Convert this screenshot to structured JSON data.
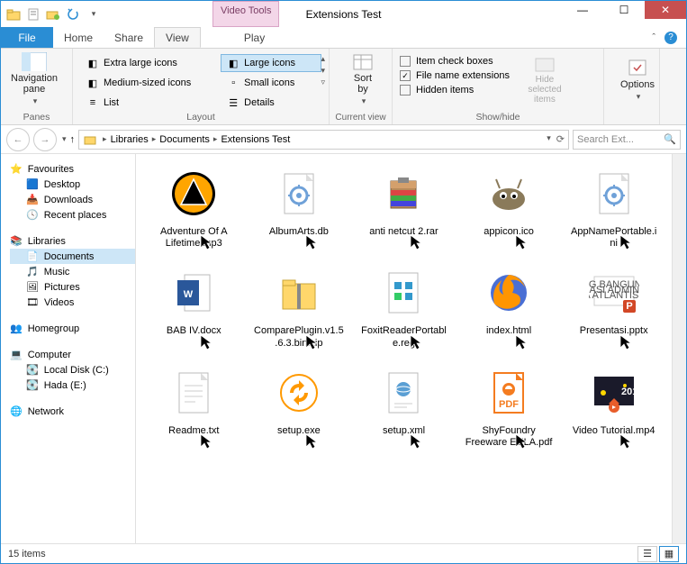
{
  "window": {
    "title": "Extensions Test",
    "tool_tab": "Video Tools"
  },
  "tabs": {
    "file": "File",
    "home": "Home",
    "share": "Share",
    "view": "View",
    "play": "Play"
  },
  "ribbon": {
    "panes": {
      "navpane": "Navigation\npane",
      "group": "Panes"
    },
    "layout": {
      "xl": "Extra large icons",
      "large": "Large icons",
      "medium": "Medium-sized icons",
      "small": "Small icons",
      "list": "List",
      "details": "Details",
      "group": "Layout"
    },
    "current": {
      "sortby": "Sort\nby",
      "group": "Current view"
    },
    "showhide": {
      "item_cb": "Item check boxes",
      "ext": "File name extensions",
      "hidden": "Hidden items",
      "hidesel": "Hide selected\nitems",
      "group": "Show/hide"
    },
    "options": "Options"
  },
  "breadcrumb": [
    "Libraries",
    "Documents",
    "Extensions Test"
  ],
  "search": {
    "placeholder": "Search Ext..."
  },
  "sidebar": {
    "favourites": {
      "head": "Favourites",
      "items": [
        "Desktop",
        "Downloads",
        "Recent places"
      ]
    },
    "libraries": {
      "head": "Libraries",
      "items": [
        "Documents",
        "Music",
        "Pictures",
        "Videos"
      ]
    },
    "homegroup": {
      "head": "Homegroup"
    },
    "computer": {
      "head": "Computer",
      "items": [
        "Local Disk (C:)",
        "Hada (E:)"
      ]
    },
    "network": {
      "head": "Network"
    }
  },
  "files": [
    {
      "name": "Adventure Of A Lifetime.mp3",
      "icon": "aimp",
      "cursor": true
    },
    {
      "name": "AlbumArts.db",
      "icon": "gear-doc",
      "cursor": true
    },
    {
      "name": "anti netcut 2.rar",
      "icon": "winrar",
      "cursor": true
    },
    {
      "name": "appicon.ico",
      "icon": "gimp",
      "cursor": true
    },
    {
      "name": "AppNamePortable.ini",
      "icon": "gear-doc",
      "cursor": true
    },
    {
      "name": "BAB IV.docx",
      "icon": "word",
      "cursor": true
    },
    {
      "name": "ComparePlugin.v1.5.6.3.bin.zip",
      "icon": "zip-folder",
      "cursor": true
    },
    {
      "name": "FoxitReaderPortable.reg",
      "icon": "reg",
      "cursor": true
    },
    {
      "name": "index.html",
      "icon": "firefox",
      "cursor": true
    },
    {
      "name": "Presentasi.pptx",
      "icon": "ppt-thumb",
      "cursor": true
    },
    {
      "name": "Readme.txt",
      "icon": "txt",
      "cursor": true
    },
    {
      "name": "setup.exe",
      "icon": "setup",
      "cursor": true
    },
    {
      "name": "setup.xml",
      "icon": "xml",
      "cursor": true
    },
    {
      "name": "ShyFoundry Freeware EULA.pdf",
      "icon": "pdf",
      "cursor": true
    },
    {
      "name": "Video Tutorial.mp4",
      "icon": "video",
      "cursor": true
    }
  ],
  "status": {
    "count": "15 items"
  },
  "colors": {
    "accent": "#2a8dd4",
    "close": "#c75050"
  }
}
